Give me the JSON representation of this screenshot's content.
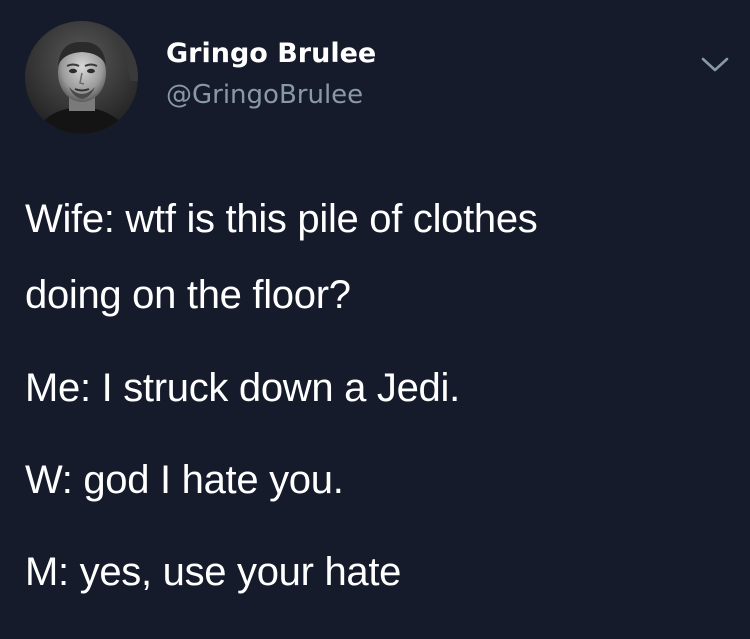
{
  "author": {
    "display_name": "Gringo Brulee",
    "handle": "@GringoBrulee"
  },
  "icons": {
    "avatar": "profile-photo",
    "menu": "chevron-down-icon"
  },
  "colors": {
    "background": "#161b2b",
    "text": "#ffffff",
    "handle": "#8899a6",
    "chevron": "#8899a6"
  },
  "tweet": {
    "lines": [
      "Wife: wtf is this pile of clothes",
      "doing on the floor?",
      "Me: I struck down a Jedi.",
      "W: god I hate you.",
      "M: yes, use your hate"
    ]
  }
}
